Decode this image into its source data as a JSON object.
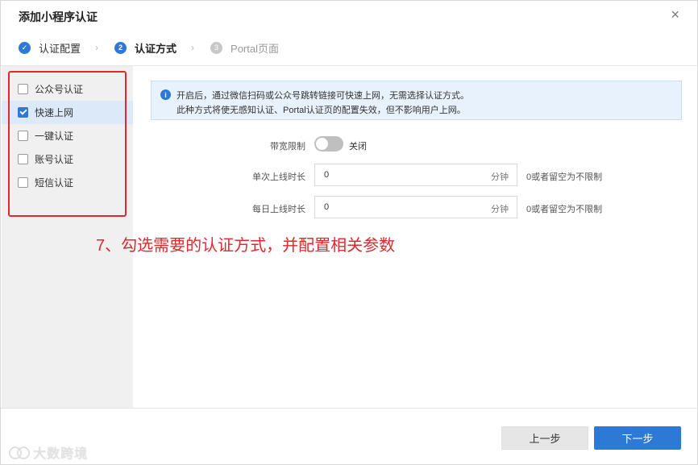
{
  "dialog": {
    "title": "添加小程序认证",
    "close_glyph": "×"
  },
  "steps": [
    {
      "number": "✓",
      "label": "认证配置",
      "state": "done"
    },
    {
      "number": "2",
      "label": "认证方式",
      "state": "active"
    },
    {
      "number": "3",
      "label": "Portal页面",
      "state": "todo"
    }
  ],
  "step_separator": "›",
  "sidebar": {
    "items": [
      {
        "label": "公众号认证",
        "checked": false
      },
      {
        "label": "快速上网",
        "checked": true
      },
      {
        "label": "一键认证",
        "checked": false
      },
      {
        "label": "账号认证",
        "checked": false
      },
      {
        "label": "短信认证",
        "checked": false
      }
    ]
  },
  "info": {
    "icon": "i",
    "line1": "开启后，通过微信扫码或公众号跳转链接可快速上网，无需选择认证方式。",
    "line2": "此种方式将使无感知认证、Portal认证页的配置失效，但不影响用户上网。"
  },
  "form": {
    "bandwidth_label": "带宽限制",
    "bandwidth_state": "关闭",
    "single_label": "单次上线时长",
    "single_value": "0",
    "single_unit": "分钟",
    "single_hint": "0或者留空为不限制",
    "daily_label": "每日上线时长",
    "daily_value": "0",
    "daily_unit": "分钟",
    "daily_hint": "0或者留空为不限制"
  },
  "annotation": "7、勾选需要的认证方式，并配置相关参数",
  "footer": {
    "prev_label": "上一步",
    "next_label": "下一步"
  },
  "watermark": "大数跨境",
  "colors": {
    "accent": "#2e78d6",
    "annotation_red": "#e0282e",
    "sidebar_bg": "#f0f0f0",
    "selected_bg": "#dbe9f8",
    "info_bg": "#e8f2fd"
  }
}
